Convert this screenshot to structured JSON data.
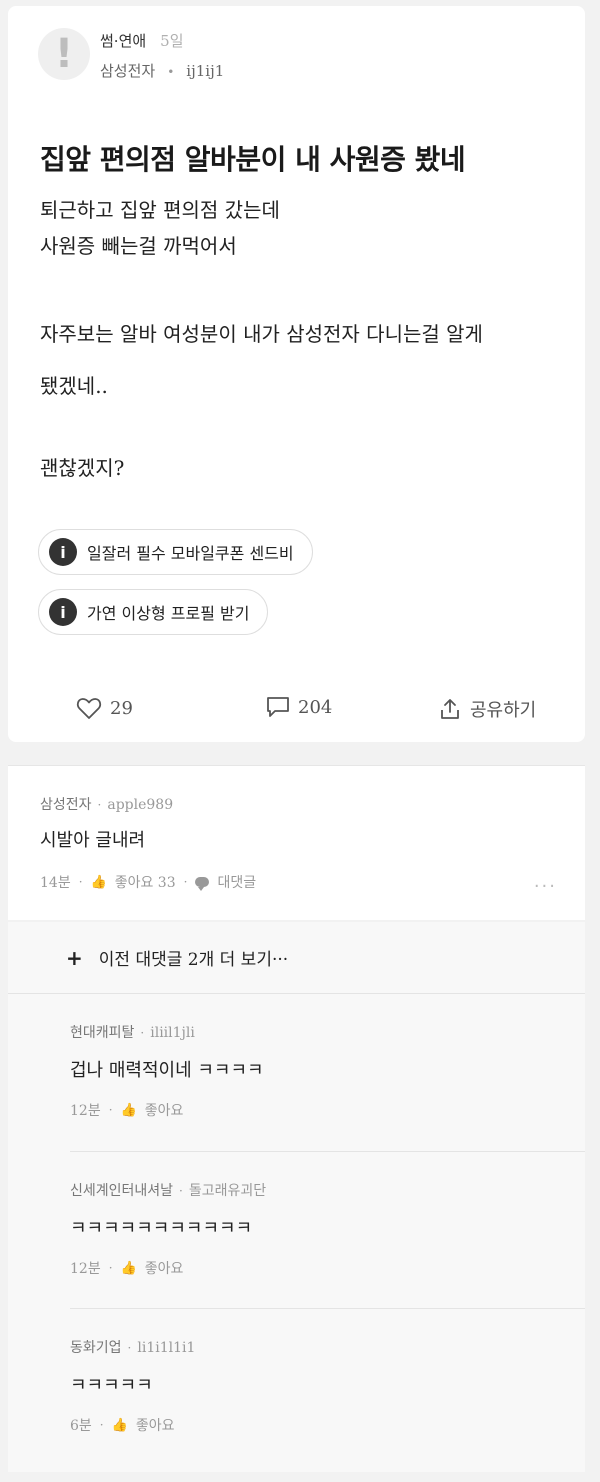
{
  "post": {
    "category": "썸·연애",
    "age": "5일",
    "company": "삼성전자",
    "author": "ij1ij1",
    "avatar_glyph": "!",
    "title": "집앞 편의점 알바분이 내 사원증 봤네",
    "body": {
      "line1": "퇴근하고 집앞 편의점 갔는데",
      "line2": "사원증 빼는걸 까먹어서",
      "line3": "자주보는 알바 여성분이 내가 삼성전자 다니는걸 알게",
      "line4": "됐겠네..",
      "line5": "괜찮겠지?"
    },
    "chips": [
      {
        "icon": "info-icon",
        "label": "일잘러 필수 모바일쿠폰 센드비"
      },
      {
        "icon": "info-icon",
        "label": "가연 이상형 프로필 받기"
      }
    ],
    "actions": {
      "likes": "29",
      "comments": "204",
      "share": "공유하기"
    }
  },
  "comment": {
    "company": "삼성전자",
    "author": "apple989",
    "text": "시발아 글내려",
    "time": "14분",
    "like_label": "좋아요 33",
    "reply_label": "대댓글",
    "more": "···"
  },
  "replies_section": {
    "prev_label": "이전 대댓글 2개 더 보기···",
    "items": [
      {
        "company": "현대캐피탈",
        "author": "iliil1jli",
        "text": "겁나 매력적이네 ㅋㅋㅋㅋ",
        "time": "12분",
        "like_label": "좋아요"
      },
      {
        "company": "신세계인터내셔날",
        "author": "돌고래유괴단",
        "text": "ㅋㅋㅋㅋㅋㅋㅋㅋㅋㅋㅋ",
        "time": "12분",
        "like_label": "좋아요"
      },
      {
        "company": "동화기업",
        "author": "li1i1l1i1",
        "text": "ㅋㅋㅋㅋㅋ",
        "time": "6분",
        "like_label": "좋아요"
      }
    ]
  }
}
